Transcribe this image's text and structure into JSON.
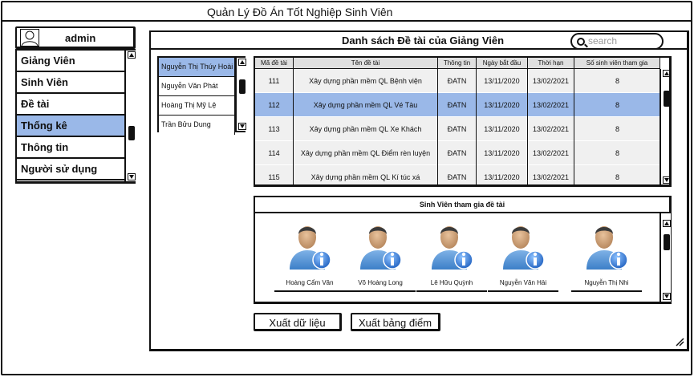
{
  "app": {
    "title": "Quản Lý Đồ Án Tốt Nghiệp Sinh Viên"
  },
  "user": {
    "name": "admin",
    "icon": "user-avatar-icon"
  },
  "nav": {
    "items": [
      {
        "label": "Giảng Viên"
      },
      {
        "label": "Sinh Viên"
      },
      {
        "label": "Đề tài"
      },
      {
        "label": "Thống kê",
        "active": true
      },
      {
        "label": "Thông tin"
      },
      {
        "label": "Người sử dụng"
      }
    ]
  },
  "main": {
    "title": "Danh sách Đề tài của Giảng Viên",
    "search": {
      "placeholder": "search",
      "value": ""
    }
  },
  "teachers": {
    "items": [
      {
        "label": "Nguyễn Thị Thúy Hoài",
        "active": true
      },
      {
        "label": "Nguyễn Văn Phát"
      },
      {
        "label": "Hoàng Thị Mỹ Lệ"
      },
      {
        "label": "Trần Bửu Dung"
      }
    ]
  },
  "topics": {
    "columns": [
      "Mã đề tài",
      "Tên đề tài",
      "Thông tin",
      "Ngày bắt đầu",
      "Thời hạn",
      "Số sinh viên tham gia"
    ],
    "rows": [
      {
        "id": "111",
        "name": "Xây dựng phần mềm QL Bệnh viện",
        "info": "ĐATN",
        "start": "13/11/2020",
        "deadline": "13/02/2021",
        "count": "8"
      },
      {
        "id": "112",
        "name": "Xây dựng phần mềm QL Vé Tàu",
        "info": "ĐATN",
        "start": "13/11/2020",
        "deadline": "13/02/2021",
        "count": "8",
        "active": true
      },
      {
        "id": "113",
        "name": "Xây dựng phần mềm QL Xe Khách",
        "info": "ĐATN",
        "start": "13/11/2020",
        "deadline": "13/02/2021",
        "count": "8"
      },
      {
        "id": "114",
        "name": "Xây dựng phần mềm QL Điểm rèn luyện",
        "info": "ĐATN",
        "start": "13/11/2020",
        "deadline": "13/02/2021",
        "count": "8"
      },
      {
        "id": "115",
        "name": "Xây dựng phần mềm QL Kí túc xá",
        "info": "ĐATN",
        "start": "13/11/2020",
        "deadline": "13/02/2021",
        "count": "8"
      }
    ]
  },
  "students": {
    "title": "Sinh Viên tham gia đề tài",
    "items": [
      {
        "name": "Hoàng Cẩm Vân"
      },
      {
        "name": "Võ Hoàng Long"
      },
      {
        "name": "Lê Hữu Quỳnh"
      },
      {
        "name": "Nguyễn Văn Hải"
      },
      {
        "name": "Nguyễn Thị Nhi"
      }
    ],
    "icon": "user-info-icon"
  },
  "buttons": {
    "export_data": "Xuất dữ liệu",
    "export_grades": "Xuất bảng điểm"
  },
  "colors": {
    "selected": "#9ab8e8",
    "header_bg": "#e0e0e0",
    "row_bg": "#f0f0f0"
  }
}
